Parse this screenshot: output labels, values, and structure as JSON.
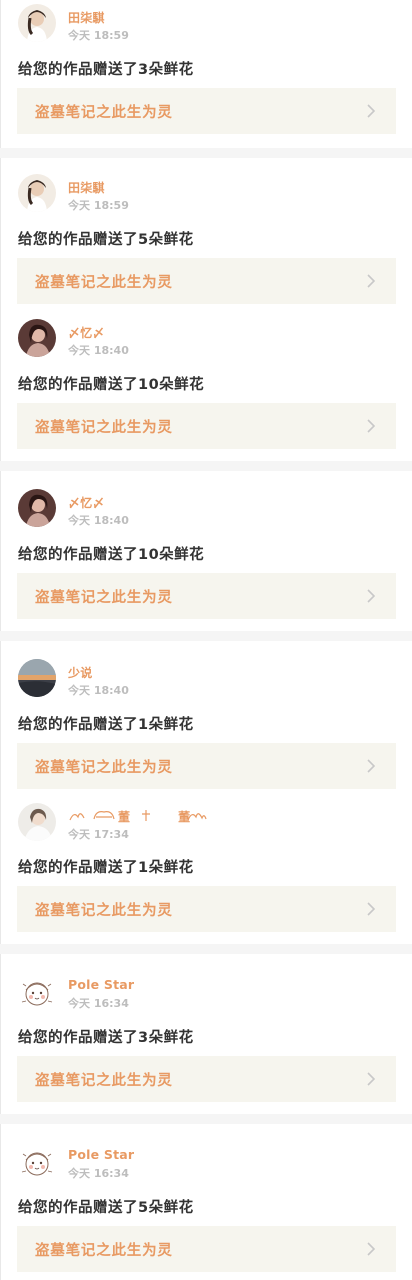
{
  "notifications": [
    {
      "user": "田柒騏",
      "time": "今天 18:59",
      "message": "给您的作品赠送了3朵鲜花",
      "work_title": "盗墓笔记之此生为灵",
      "avatar": "avatar-girl-cream"
    },
    {
      "user": "田柒騏",
      "time": "今天 18:59",
      "message": "给您的作品赠送了5朵鲜花",
      "work_title": "盗墓笔记之此生为灵",
      "avatar": "avatar-girl-cream"
    },
    {
      "user": "〆忆〆",
      "time": "今天 18:40",
      "message": "给您的作品赠送了10朵鲜花",
      "work_title": "盗墓笔记之此生为灵",
      "avatar": "avatar-girl-dark"
    },
    {
      "user": "〆忆〆",
      "time": "今天 18:40",
      "message": "给您的作品赠送了10朵鲜花",
      "work_title": "盗墓笔记之此生为灵",
      "avatar": "avatar-girl-dark"
    },
    {
      "user": "少说",
      "time": "今天 18:40",
      "message": "给您的作品赠送了1朵鲜花",
      "work_title": "盗墓笔记之此生为灵",
      "avatar": "avatar-sunset"
    },
    {
      "user": "董 董",
      "time": "今天 17:34",
      "message": "给您的作品赠送了1朵鲜花",
      "work_title": "盗墓笔记之此生为灵",
      "avatar": "avatar-girl-white"
    },
    {
      "user": "Pole Star",
      "time": "今天 16:34",
      "message": "给您的作品赠送了3朵鲜花",
      "work_title": "盗墓笔记之此生为灵",
      "avatar": "avatar-cartoon"
    },
    {
      "user": "Pole Star",
      "time": "今天 16:34",
      "message": "给您的作品赠送了5朵鲜花",
      "work_title": "盗墓笔记之此生为灵",
      "avatar": "avatar-cartoon"
    }
  ],
  "colors": {
    "accent": "#e89a63",
    "card_bg": "#f6f5ee",
    "divider": "#f5f5f5",
    "text": "#333333",
    "time": "#bdbdbd"
  },
  "icons": {
    "chevron": "chevron-right-icon"
  }
}
